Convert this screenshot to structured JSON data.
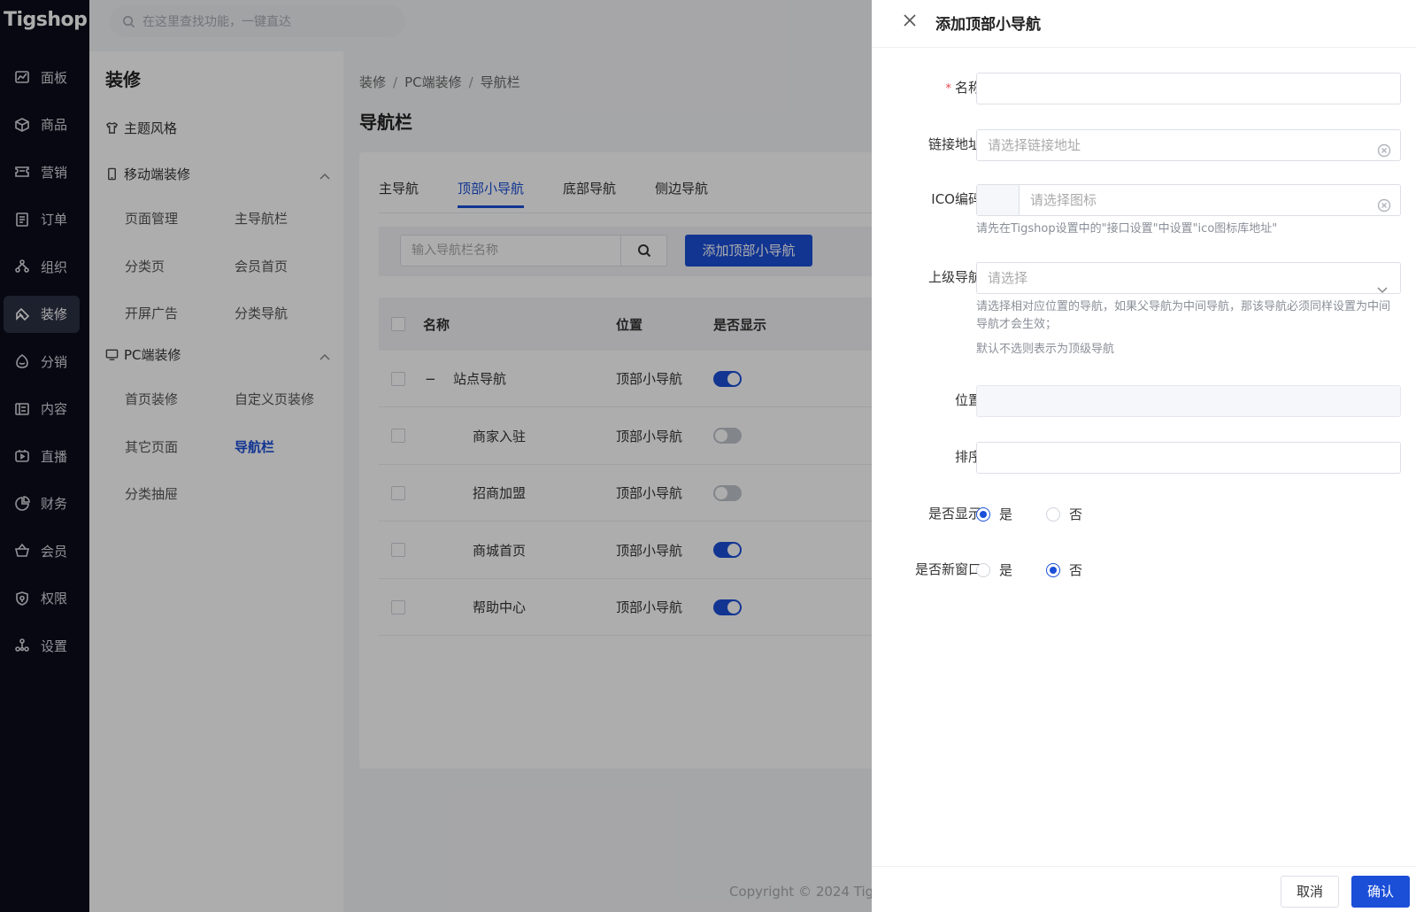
{
  "app": {
    "logo": "Tigshop"
  },
  "search": {
    "placeholder": "在这里查找功能，一键直达"
  },
  "rail": {
    "items": [
      {
        "label": "面板",
        "icon": "chart-icon"
      },
      {
        "label": "商品",
        "icon": "box-icon"
      },
      {
        "label": "营销",
        "icon": "ticket-icon"
      },
      {
        "label": "订单",
        "icon": "order-icon"
      },
      {
        "label": "组织",
        "icon": "org-icon"
      },
      {
        "label": "装修",
        "icon": "brush-icon"
      },
      {
        "label": "分销",
        "icon": "share-icon"
      },
      {
        "label": "内容",
        "icon": "content-icon"
      },
      {
        "label": "直播",
        "icon": "live-icon"
      },
      {
        "label": "财务",
        "icon": "pie-icon"
      },
      {
        "label": "会员",
        "icon": "basket-icon"
      },
      {
        "label": "权限",
        "icon": "shield-icon"
      },
      {
        "label": "设置",
        "icon": "settings-icon"
      }
    ],
    "active_index": 5
  },
  "subside": {
    "title": "装修",
    "theme": "主题风格",
    "mobile_group": "移动端装修",
    "mobile_links": [
      "页面管理",
      "主导航栏",
      "分类页",
      "会员首页",
      "开屏广告",
      "分类导航"
    ],
    "pc_group": "PC端装修",
    "pc_links": [
      "首页装修",
      "自定义页装修",
      "其它页面",
      "导航栏",
      "分类抽屉"
    ]
  },
  "breadcrumb": [
    "装修",
    "PC端装修",
    "导航栏"
  ],
  "page": {
    "title": "导航栏"
  },
  "tabs": [
    "主导航",
    "顶部小导航",
    "底部导航",
    "侧边导航"
  ],
  "filter": {
    "placeholder": "输入导航栏名称",
    "add_button": "添加顶部小导航"
  },
  "table": {
    "headers": {
      "name": "名称",
      "position": "位置",
      "show": "是否显示"
    },
    "rows": [
      {
        "name": "站点导航",
        "position": "顶部小导航",
        "show": true,
        "expanded": true,
        "collapse": "−"
      },
      {
        "name": "商家入驻",
        "position": "顶部小导航",
        "show": false
      },
      {
        "name": "招商加盟",
        "position": "顶部小导航",
        "show": false
      },
      {
        "name": "商城首页",
        "position": "顶部小导航",
        "show": true
      },
      {
        "name": "帮助中心",
        "position": "顶部小导航",
        "show": true
      }
    ]
  },
  "copyright": "Copyright © 2024 Tig",
  "drawer": {
    "title": "添加顶部小导航",
    "fields": {
      "name": {
        "label": "名称",
        "required_mark": "*",
        "value": ""
      },
      "link": {
        "label": "链接地址",
        "placeholder": "请选择链接地址"
      },
      "ico": {
        "label": "ICO编码",
        "placeholder": "请选择图标",
        "hint": "请先在Tigshop设置中的\"接口设置\"中设置\"ico图标库地址\""
      },
      "parent": {
        "label": "上级导航",
        "placeholder": "请选择",
        "hint1": "请选择相对应位置的导航，如果父导航为中间导航，那该导航必须同样设置为中间导航才会生效；",
        "hint2": "默认不选则表示为顶级导航"
      },
      "position": {
        "label": "位置",
        "value": ""
      },
      "sort": {
        "label": "排序",
        "value": ""
      },
      "show": {
        "label": "是否显示",
        "yes": "是",
        "no": "否",
        "selected": "yes"
      },
      "new_window": {
        "label": "是否新窗口",
        "yes": "是",
        "no": "否",
        "selected": "no"
      }
    },
    "cancel": "取消",
    "confirm": "确认"
  },
  "colors": {
    "primary": "#1b4fd8",
    "rail_bg": "#0b0d1a"
  }
}
